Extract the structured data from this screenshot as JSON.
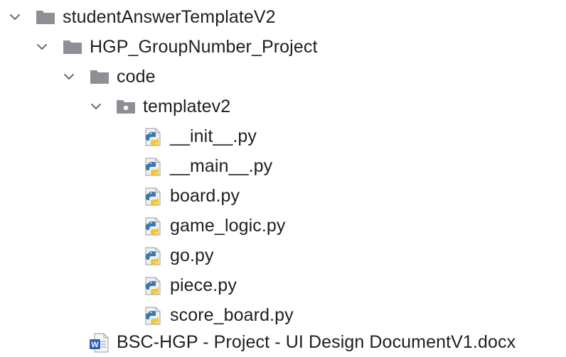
{
  "project_tree": {
    "root": {
      "label": "studentAnswerTemplateV2",
      "expanded": true,
      "icon": "folder-icon"
    },
    "project": {
      "label": "HGP_GroupNumber_Project",
      "expanded": true,
      "icon": "folder-icon"
    },
    "code": {
      "label": "code",
      "expanded": true,
      "icon": "folder-icon"
    },
    "package": {
      "label": "templatev2",
      "expanded": true,
      "icon": "package-folder-icon"
    },
    "files": [
      {
        "label": "__init__.py",
        "icon": "python-file-icon"
      },
      {
        "label": "__main__.py",
        "icon": "python-file-icon"
      },
      {
        "label": "board.py",
        "icon": "python-file-icon"
      },
      {
        "label": "game_logic.py",
        "icon": "python-file-icon"
      },
      {
        "label": "go.py",
        "icon": "python-file-icon"
      },
      {
        "label": "piece.py",
        "icon": "python-file-icon"
      },
      {
        "label": "score_board.py",
        "icon": "python-file-icon"
      }
    ],
    "document": {
      "label": "BSC-HGP - Project - UI Design DocumentV1.docx",
      "icon": "word-document-icon"
    }
  },
  "colors": {
    "folder": "#8c9095",
    "chevron": "#6e6e6e",
    "text": "#1e1e1e",
    "python_blue": "#3b78ae",
    "python_yellow": "#f2c630",
    "word_blue": "#2b5fb8"
  }
}
